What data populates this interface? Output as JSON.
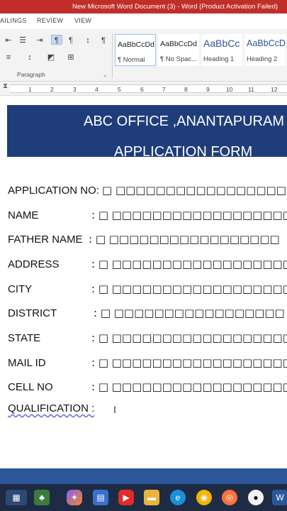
{
  "window": {
    "title": "New Microsoft Word Document (3) -  Word (Product Activation Failed)"
  },
  "ribbon": {
    "tabs": [
      "AILINGS",
      "REVIEW",
      "VIEW"
    ],
    "paragraph_group_label": "Paragraph",
    "styles": [
      {
        "sample": "AaBbCcDd",
        "name": "¶ Normal"
      },
      {
        "sample": "AaBbCcDd",
        "name": "¶ No Spac..."
      },
      {
        "sample": "AaBbCc",
        "name": "Heading 1"
      },
      {
        "sample": "AaBbCcD",
        "name": "Heading 2"
      }
    ]
  },
  "ruler": {
    "numbers": [
      "1",
      "1",
      "2",
      "3",
      "4",
      "5",
      "6",
      "7",
      "8",
      "9",
      "10",
      "11",
      "12"
    ]
  },
  "document": {
    "banner": {
      "line1": "ABC OFFICE ,ANANTAPURAM",
      "line2": "APPLICATION FORM"
    },
    "fields": [
      {
        "label": "APPLICATION NO:",
        "value": "□ □□□□□□□□□□□□□□□□□"
      },
      {
        "label": "NAME",
        "value": ": □ □□□□□□□□□□□□□□□□□□"
      },
      {
        "label": "FATHER NAME",
        "value": ": □ □□□□□□□□□□□□□□□□□"
      },
      {
        "label": "ADDRESS",
        "value": ": □ □□□□□□□□□□□□□□□□□□"
      },
      {
        "label": "CITY",
        "value": ": □ □□□□□□□□□□□□□□□□□□"
      },
      {
        "label": "DISTRICT",
        "value": ": □ □□□□□□□□□□□□□□□□□"
      },
      {
        "label": "STATE",
        "value": ": □ □□□□□□□□□□□□□□□□□□"
      },
      {
        "label": "MAIL ID",
        "value": ": □ □□□□□□□□□□□□□□□□□□"
      },
      {
        "label": "CELL NO",
        "value": ": □ □□□□□□□□□□□□□□□□□□"
      }
    ],
    "qualification_label": "QUALIFICATION  :"
  },
  "colors": {
    "title_bar": "#c12e2a",
    "banner": "#1f3d7a",
    "status_band": "#2b579a",
    "taskbar": "#1e2b45"
  },
  "taskbar": {
    "icons": [
      "widgets-icon",
      "store-bag-icon",
      "copilot-icon",
      "calendar-app-icon",
      "youtube-icon",
      "file-explorer-icon",
      "edge-icon",
      "chrome-icon",
      "firefox-icon",
      "github-icon",
      "word-icon"
    ]
  }
}
